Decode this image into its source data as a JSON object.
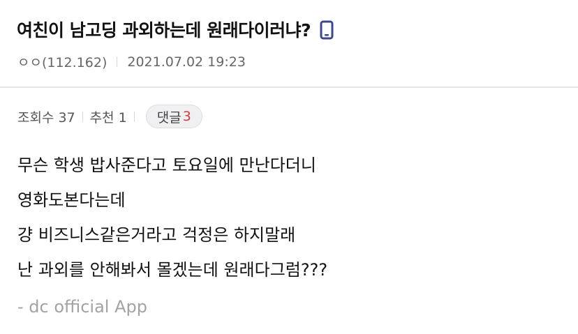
{
  "post": {
    "title": "여친이 남고딩 과외하는데 원래다이러냐?",
    "author": "ㅇㅇ(112.162)",
    "date": "2021.07.02 19:23",
    "device_icon": "mobile-phone-icon"
  },
  "stats": {
    "views": "조회수 37",
    "recommend": "추천 1",
    "comments_label": "댓글",
    "comments_count": "3"
  },
  "body": {
    "lines": [
      "무슨 학생 밥사준다고 토요일에 만난다더니",
      "영화도본다는데",
      "걍 비즈니스같은거라고 걱정은 하지말래",
      "난 과외를 안해봐서 몰겠는데 원래다그럼???"
    ],
    "signature": "- dc official App"
  },
  "colors": {
    "accent": "#3b4890",
    "comment_count": "#d43b3b",
    "divider": "#e4e4ee"
  }
}
